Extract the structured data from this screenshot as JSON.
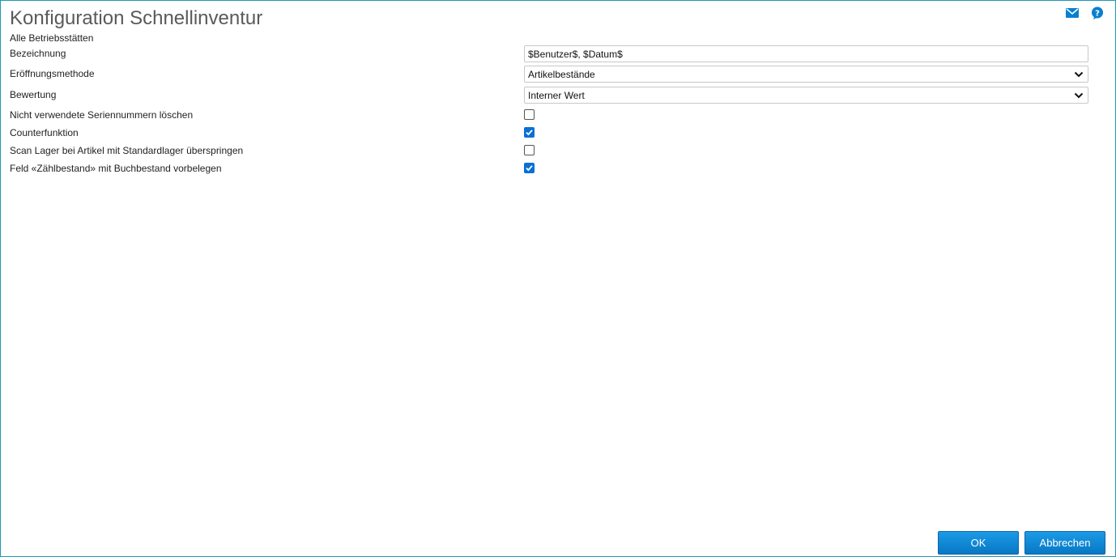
{
  "window": {
    "title": "Konfiguration Schnellinventur",
    "subtitle": "Alle Betriebsstätten"
  },
  "header_icons": {
    "mail_icon": "mail-icon",
    "help_icon": "help-icon"
  },
  "form": {
    "bezeichnung": {
      "label": "Bezeichnung",
      "value": "$Benutzer$, $Datum$"
    },
    "eroeffnungsmethode": {
      "label": "Eröffnungsmethode",
      "selected": "Artikelbestände"
    },
    "bewertung": {
      "label": "Bewertung",
      "selected": "Interner Wert"
    },
    "seriennummern": {
      "label": "Nicht verwendete Seriennummern löschen",
      "checked": false
    },
    "counterfunktion": {
      "label": "Counterfunktion",
      "checked": true
    },
    "scan_lager": {
      "label": "Scan Lager bei Artikel mit Standardlager überspringen",
      "checked": false
    },
    "zaehlbestand": {
      "label": "Feld «Zählbestand» mit Buchbestand vorbelegen",
      "checked": true
    }
  },
  "footer": {
    "ok_label": "OK",
    "cancel_label": "Abbrechen"
  },
  "colors": {
    "accent": "#0a6fd6",
    "border": "#1a9ab5",
    "button": "#0878c4"
  }
}
